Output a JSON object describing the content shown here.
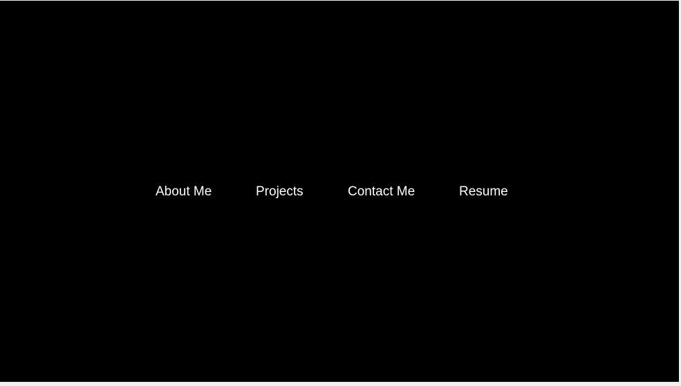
{
  "nav": {
    "items": [
      {
        "label": "About Me"
      },
      {
        "label": "Projects"
      },
      {
        "label": "Contact Me"
      },
      {
        "label": "Resume"
      }
    ]
  },
  "colors": {
    "background": "#000000",
    "text": "#ffffff",
    "page_border": "#f0f0f0"
  }
}
